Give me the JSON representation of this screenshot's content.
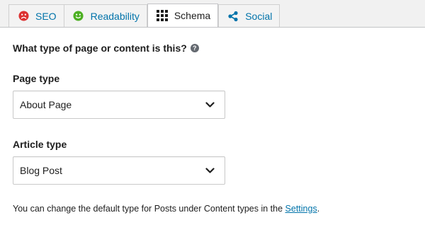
{
  "tabs": [
    {
      "label": "SEO",
      "icon": "frown-face-icon",
      "color": "#dc3232"
    },
    {
      "label": "Readability",
      "icon": "smiley-face-icon",
      "color": "#7ad03a"
    },
    {
      "label": "Schema",
      "icon": "grid-icon"
    },
    {
      "label": "Social",
      "icon": "share-icon"
    }
  ],
  "active_tab": "Schema",
  "schema": {
    "question": "What type of page or content is this?",
    "page_type_label": "Page type",
    "page_type_value": "About Page",
    "article_type_label": "Article type",
    "article_type_value": "Blog Post",
    "note_prefix": "You can change the default type for Posts under Content types in the ",
    "note_link": "Settings",
    "note_suffix": "."
  },
  "colors": {
    "link": "#0073aa",
    "seo_bad": "#dc3232",
    "readability_good": "#7ad03a"
  }
}
